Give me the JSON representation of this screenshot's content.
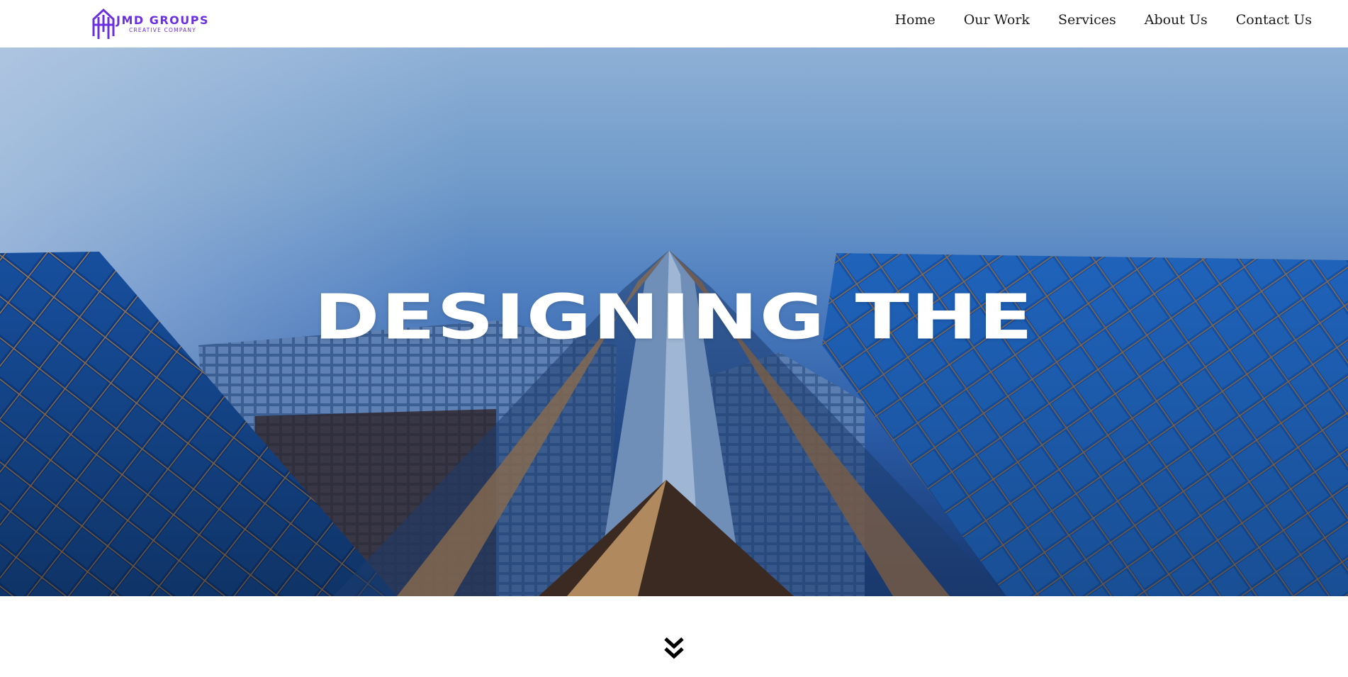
{
  "brand": {
    "name": "JMD GROUPS",
    "tagline": "CREATIVE COMPANY",
    "color": "#6a2fe0"
  },
  "nav": {
    "items": [
      {
        "label": "Home"
      },
      {
        "label": "Our Work"
      },
      {
        "label": "Services"
      },
      {
        "label": "About Us"
      },
      {
        "label": "Contact Us"
      }
    ]
  },
  "hero": {
    "headline": "DESIGNING THE"
  },
  "scroll": {
    "icon": "double-chevron-down-icon"
  }
}
